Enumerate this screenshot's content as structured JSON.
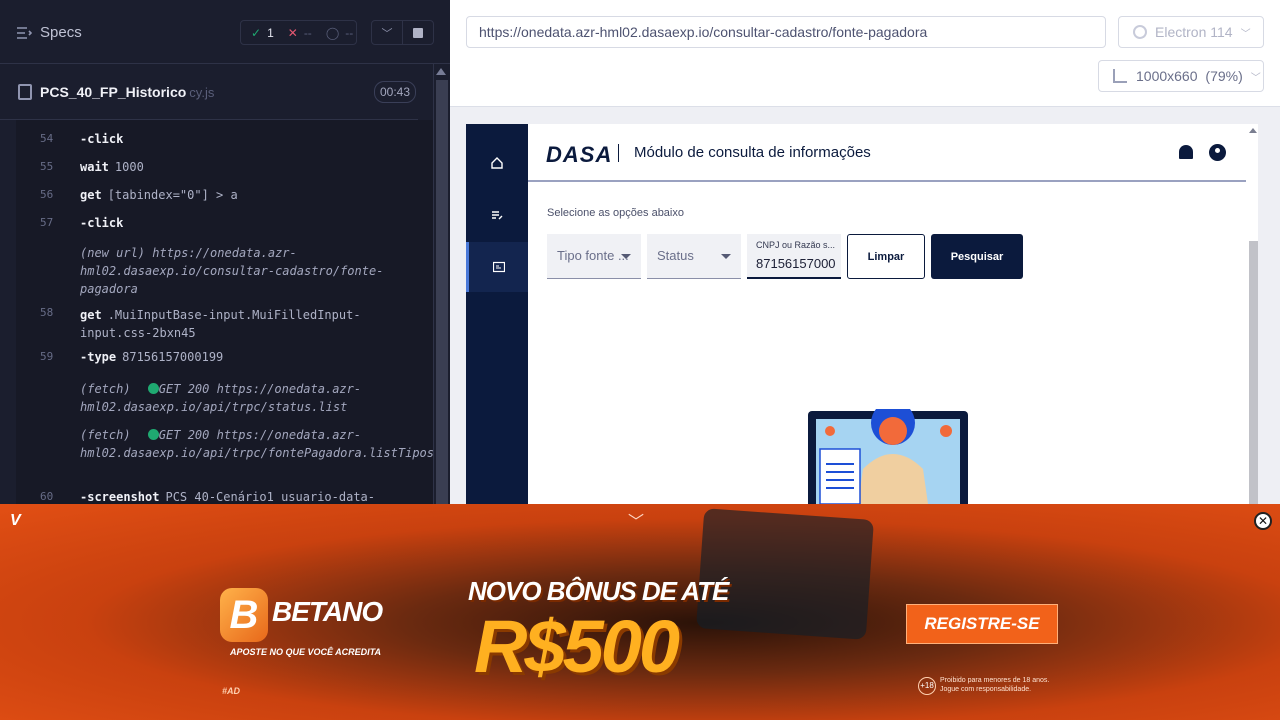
{
  "runner": {
    "specs_label": "Specs",
    "stats": {
      "passed": "1",
      "failed": "--",
      "pending": "--"
    },
    "file": {
      "name": "PCS_40_FP_Historico",
      "ext": "cy.js",
      "duration": "00:43"
    },
    "log": [
      {
        "line": "54",
        "cmd": "-click",
        "arg": ""
      },
      {
        "line": "55",
        "cmd": "wait",
        "arg": "1000"
      },
      {
        "line": "56",
        "cmd": "get",
        "arg": "[tabindex=\"0\"] > a"
      },
      {
        "line": "57",
        "cmd": "-click",
        "arg": ""
      },
      {
        "line": "",
        "info": "(new url)  https://onedata.azr-hml02.dasaexp.io/consultar-cadastro/fonte-pagadora"
      },
      {
        "line": "58",
        "cmd": "get",
        "arg": ".MuiInputBase-input.MuiFilledInput-input.css-2bxn45"
      },
      {
        "line": "59",
        "cmd": "-type",
        "arg": "87156157000199"
      },
      {
        "line": "",
        "info": "(fetch)  GET 200 https://onedata.azr-hml02.dasaexp.io/api/trpc/status.list"
      },
      {
        "line": "",
        "info": "(fetch)  GET 200 https://onedata.azr-hml02.dasaexp.io/api/trpc/fontePagadora.listTipos"
      },
      {
        "line": "60",
        "cmd": "-screenshot",
        "arg": "PCS 40-Cenário1 usuario-data-"
      }
    ]
  },
  "aut": {
    "url": "https://onedata.azr-hml02.dasaexp.io/consultar-cadastro/fonte-pagadora",
    "browser": "Electron 114",
    "viewport": "1000x660",
    "zoom": "(79%)"
  },
  "app": {
    "logo": "DASA",
    "title": "Módulo de consulta de informações",
    "select_label": "Selecione as opções abaixo",
    "filter_type": "Tipo fonte ...",
    "filter_status": "Status",
    "cnpj_label": "CNPJ ou Razão s...",
    "cnpj_value": "87156157000",
    "clear_button": "Limpar",
    "search_button": "Pesquisar"
  },
  "ad": {
    "badge": "V",
    "brand": "BETANO",
    "tagline": "APOSTE NO QUE VOCÊ ACREDITA",
    "headline": "NOVO BÔNUS DE ATÉ",
    "amount": "R$500",
    "cta": "REGISTRE-SE",
    "hashtag": "#AD",
    "age": "18",
    "legal": "Proibido para menores de 18 anos. Jogue com responsabilidade."
  }
}
